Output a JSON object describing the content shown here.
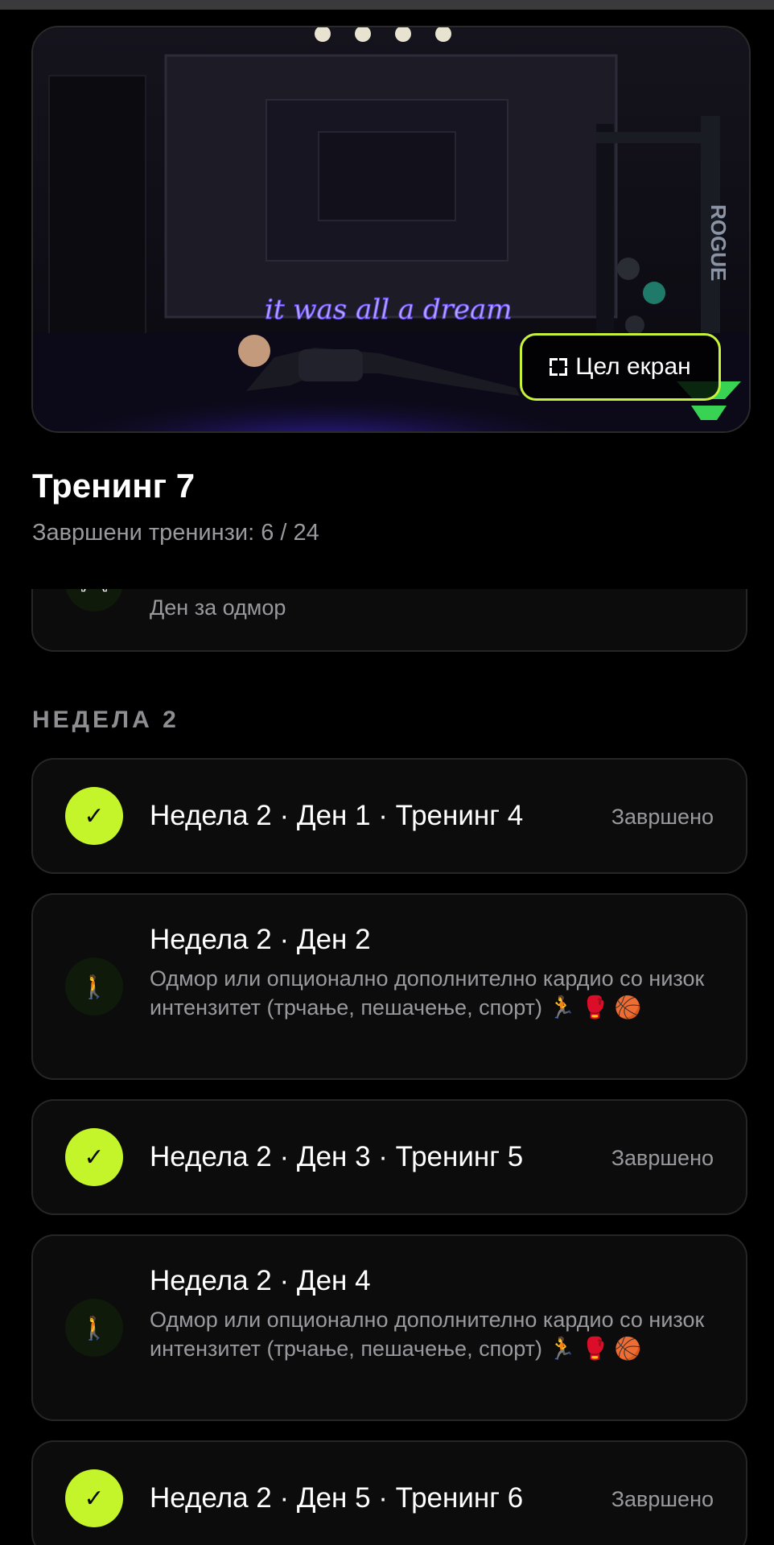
{
  "video": {
    "neon_text": "it was all a dream",
    "brand": "ROGUE",
    "fullscreen_label": "Цел екран"
  },
  "header": {
    "title": "Тренинг 7",
    "progress": "Завршени тренинзи: 6 / 24"
  },
  "partial_card": {
    "icon": "bed-icon",
    "emoji": "🛏",
    "label": "Ден за одмор"
  },
  "week2": {
    "heading": "НЕДЕЛА 2",
    "items": [
      {
        "title": "Недела 2 · Ден 1 · Тренинг 4",
        "status": "Завршено",
        "icon": "check-icon",
        "mark": "✓"
      },
      {
        "title": "Недела 2 · Ден 2",
        "description": "Одмор или опционално дополнително кардио со низок интензитет (трчање, пешачење, спорт) 🏃 🥊 🏀",
        "icon": "walking-person-icon",
        "emoji": "🚶"
      },
      {
        "title": "Недела 2 · Ден 3 · Тренинг 5",
        "status": "Завршено",
        "icon": "check-icon",
        "mark": "✓"
      },
      {
        "title": "Недела 2 · Ден 4",
        "description": "Одмор или опционално дополнително кардио со низок интензитет (трчање, пешачење, спорт) 🏃 🥊 🏀",
        "icon": "walking-person-icon",
        "emoji": "🚶"
      },
      {
        "title": "Недела 2 · Ден 5 · Тренинг 6",
        "status": "Завршено",
        "icon": "check-icon",
        "mark": "✓"
      }
    ]
  },
  "colors": {
    "accent": "#c4f52a",
    "neon": "#6b4dff",
    "muted_text": "#9a9a9e",
    "card_bg": "#0c0c0d"
  }
}
